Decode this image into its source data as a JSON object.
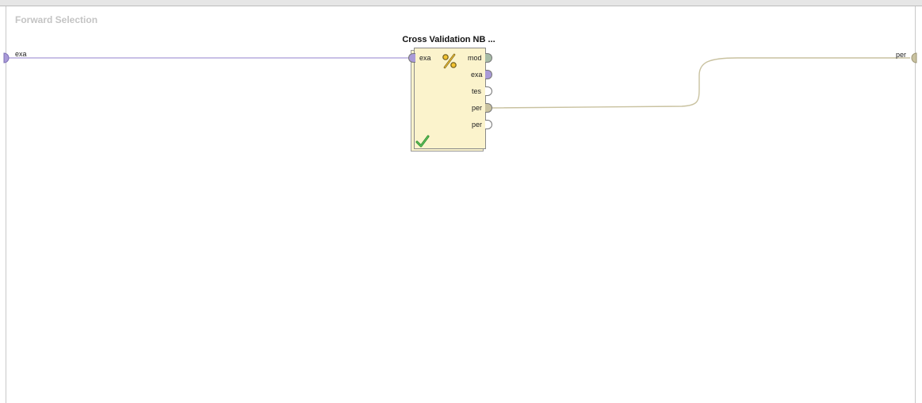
{
  "process": {
    "title": "Forward Selection"
  },
  "input_port": {
    "label": "exa",
    "color": "#a99ad8"
  },
  "output_port": {
    "label": "per",
    "color": "#c9c2a0"
  },
  "operator": {
    "name": "Cross Validation NB ...",
    "icon": "percent-icon",
    "status_icon": "checkmark-icon",
    "input_ports": [
      {
        "label": "exa",
        "color": "#a99ad8"
      }
    ],
    "output_ports": [
      {
        "label": "mod",
        "color": "#a6bba6"
      },
      {
        "label": "exa",
        "color": "#a99ad8"
      },
      {
        "label": "tes",
        "color": "#ffffff"
      },
      {
        "label": "per",
        "color": "#c9c2a0"
      },
      {
        "label": "per",
        "color": "#ffffff"
      }
    ]
  },
  "wire_colors": {
    "example_set": "#a99ad8",
    "performance": "#c9c2a0"
  }
}
